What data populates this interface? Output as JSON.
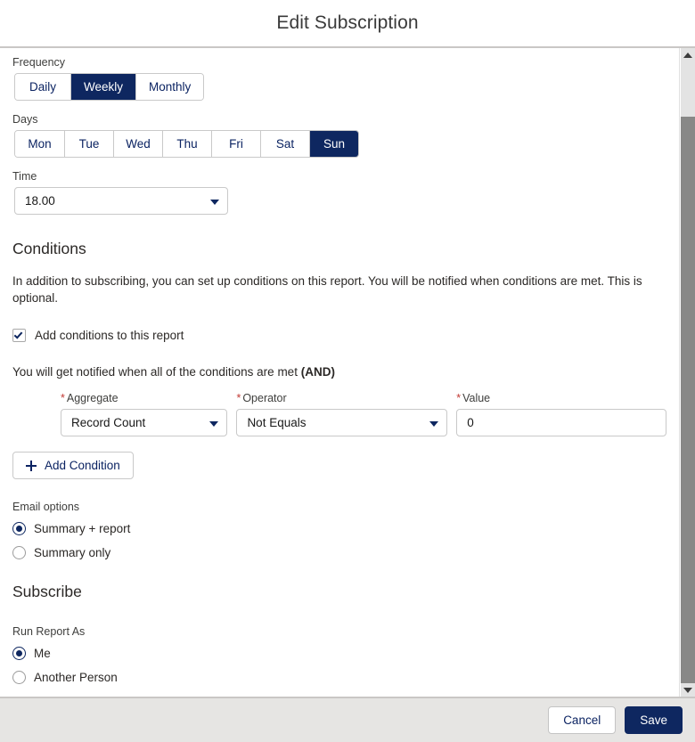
{
  "header": {
    "title": "Edit Subscription"
  },
  "frequency": {
    "label": "Frequency",
    "options": [
      "Daily",
      "Weekly",
      "Monthly"
    ],
    "selected": "Weekly"
  },
  "days": {
    "label": "Days",
    "options": [
      "Mon",
      "Tue",
      "Wed",
      "Thu",
      "Fri",
      "Sat",
      "Sun"
    ],
    "selected": "Sun"
  },
  "time": {
    "label": "Time",
    "value": "18.00",
    "caret_icon": "chevron-down-icon"
  },
  "conditions": {
    "heading": "Conditions",
    "description": "In addition to subscribing, you can set up conditions on this report. You will be notified when conditions are met. This is optional.",
    "checkbox_label": "Add conditions to this report",
    "checkbox_checked": true,
    "checkbox_icon": "check-icon",
    "notify_text_plain": "You will get notified when all of the conditions are met ",
    "notify_text_bold": "(AND)",
    "row": {
      "aggregate": {
        "label": "Aggregate",
        "required": "*",
        "value": "Record Count"
      },
      "operator": {
        "label": "Operator",
        "required": "*",
        "value": "Not Equals"
      },
      "value": {
        "label": "Value",
        "required": "*",
        "value": "0"
      }
    },
    "add_condition": {
      "label": "Add Condition",
      "icon": "plus-icon"
    }
  },
  "email_options": {
    "label": "Email options",
    "options": [
      "Summary + report",
      "Summary only"
    ],
    "selected": "Summary + report"
  },
  "subscribe": {
    "heading": "Subscribe",
    "run_report_as_label": "Run Report As",
    "options": [
      "Me",
      "Another Person"
    ],
    "selected": "Me"
  },
  "footer": {
    "cancel_label": "Cancel",
    "save_label": "Save"
  },
  "scrollbar": {
    "up_icon": "scroll-up-arrow-icon",
    "down_icon": "scroll-down-arrow-icon"
  },
  "colors": {
    "brand_navy": "#0e2760",
    "link_navy": "#0b2362",
    "required_red": "#c23934",
    "border_gray": "#c9c9c9",
    "footer_bg": "#e6e5e3"
  }
}
